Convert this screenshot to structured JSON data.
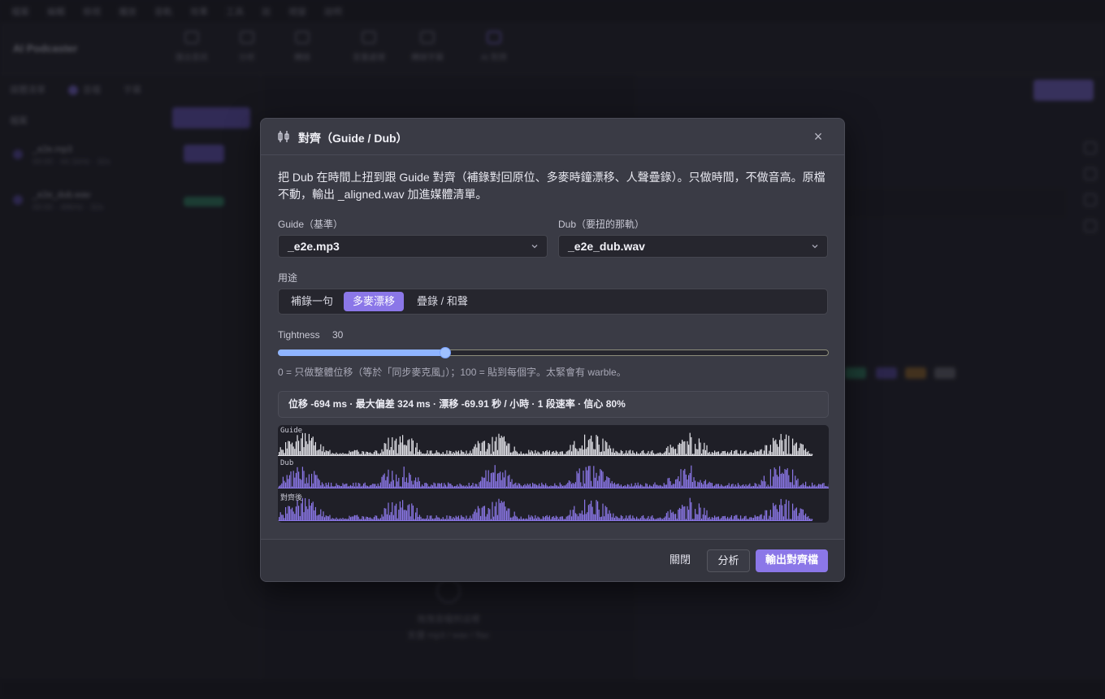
{
  "background": {
    "menu": [
      "檔案",
      "編輯",
      "檢視",
      "播放",
      "音軌",
      "效果",
      "工具",
      "說",
      "視窗",
      "說明"
    ],
    "app_title": "AI Podcaster",
    "toolbar_items": [
      "匯出音訊",
      "分析",
      "轉錄",
      "音量處理",
      "轉錄字幕",
      "AI 對齊"
    ],
    "left_tabs": [
      "媒體清單",
      "音檔",
      "字幕"
    ],
    "left_label": "檔案",
    "files": [
      {
        "name": "_e2e.mp3",
        "meta": "00:00 · 44.1kHz · 32s"
      },
      {
        "name": "_e2e_dub.wav",
        "meta": "00:00 · 48kHz · 32s"
      }
    ],
    "center_drop_title": "拖曳音檔到這裡",
    "center_drop_sub": "支援 mp3 / wav / flac"
  },
  "dialog": {
    "title": "對齊（Guide / Dub）",
    "description": "把 Dub 在時間上扭到跟 Guide 對齊（補錄對回原位、多麥時鐘漂移、人聲疊錄）。只做時間，不做音高。原檔不動，輸出 _aligned.wav 加進媒體清單。",
    "guide_label": "Guide（基準）",
    "guide_value": "_e2e.mp3",
    "dub_label": "Dub（要扭的那軌）",
    "dub_value": "_e2e_dub.wav",
    "purpose_label": "用途",
    "purpose_options": [
      "補錄一句",
      "多麥漂移",
      "疊錄 / 和聲"
    ],
    "purpose_selected": 1,
    "tightness_label": "Tightness",
    "tightness_value": 30,
    "tightness_max": 100,
    "tightness_hint": "0 = 只做整體位移（等於「同步麥克風」）；100 = 貼到每個字。太緊會有 warble。",
    "result_text": "位移 -694 ms · 最大偏差 324 ms · 漂移 -69.91 秒 / 小時 · 1 段速率 · 信心 80%",
    "tracks": [
      {
        "label": "Guide",
        "color": "#e4e4ea",
        "extent": 0.97,
        "seed": 3
      },
      {
        "label": "Dub",
        "color": "#8b77e8",
        "extent": 1.0,
        "seed": 11
      },
      {
        "label": "對齊後",
        "color": "#8b77e8",
        "extent": 0.97,
        "seed": 3
      }
    ],
    "buttons": {
      "close": "關閉",
      "analyze": "分析",
      "export": "輸出對齊檔"
    },
    "close_icon": "close-icon",
    "header_icon": "align-icon"
  }
}
